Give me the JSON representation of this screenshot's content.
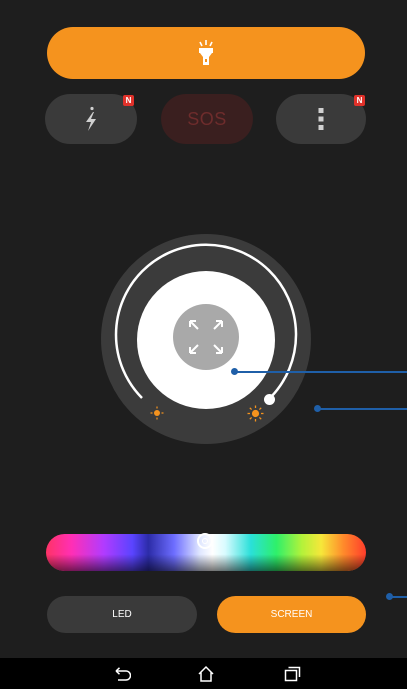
{
  "toolbar": {
    "torch_icon": "flashlight-icon",
    "strobe_icon": "strobe-lightning-icon",
    "sos_label": "SOS",
    "more_icon": "more-vert-icon",
    "new_badge": "N"
  },
  "dial": {
    "expand_icon": "expand-fullscreen-icon",
    "min_icon": "brightness-low-icon",
    "max_icon": "brightness-high-icon"
  },
  "modes": {
    "led_label": "LED",
    "screen_label": "SCREEN",
    "selected": "SCREEN"
  },
  "nav": {
    "back_icon": "back-icon",
    "home_icon": "home-icon",
    "recents_icon": "recents-icon"
  },
  "colors": {
    "accent": "#f5931e",
    "background": "#1e1e1e",
    "pill": "#3a3a3a",
    "sos_bg": "#3a1f1f",
    "sos_text": "#6e2c2c",
    "badge": "#e0312a",
    "callout": "#1f5fa8"
  }
}
